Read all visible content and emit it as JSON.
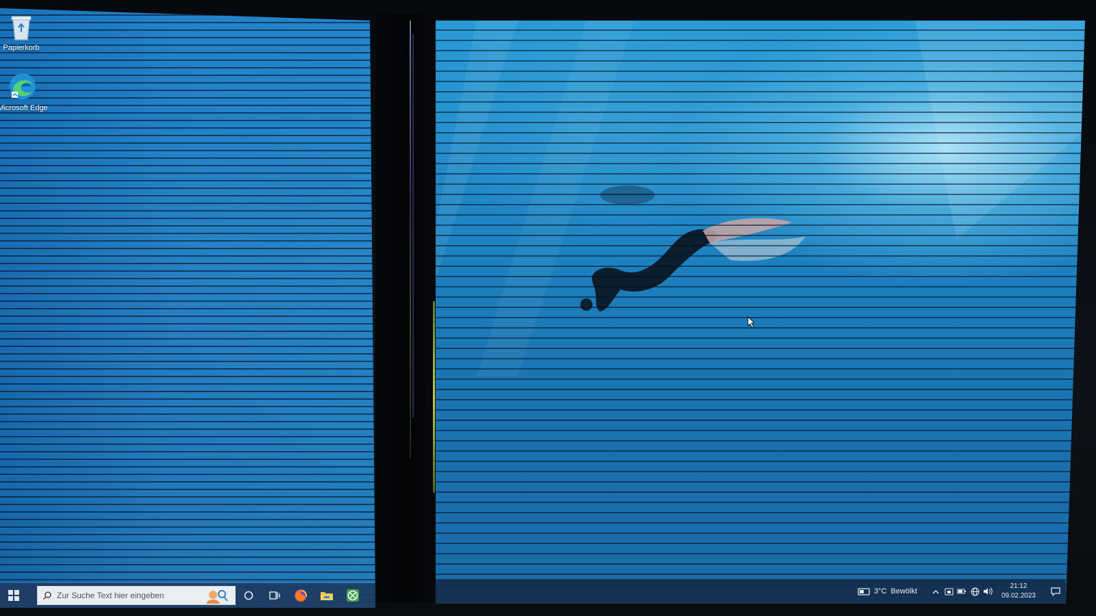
{
  "desktop": {
    "icons": [
      {
        "label": "Papierkorb",
        "icon": "recycle-bin-icon"
      },
      {
        "label": "Microsoft Edge",
        "icon": "edge-icon"
      }
    ]
  },
  "taskbar": {
    "search_placeholder": "Zur Suche Text hier eingeben",
    "pinned": [
      "cortana-icon",
      "task-view-icon",
      "firefox-icon",
      "file-explorer-icon",
      "xbox-icon"
    ]
  },
  "tray": {
    "weather_temp": "3°C",
    "weather_text": "Bewölkt",
    "time": "21:12",
    "date": "09.02.2023"
  },
  "colors": {
    "accent_water": "#1e84c2",
    "taskbar": "#1e3c5f"
  }
}
